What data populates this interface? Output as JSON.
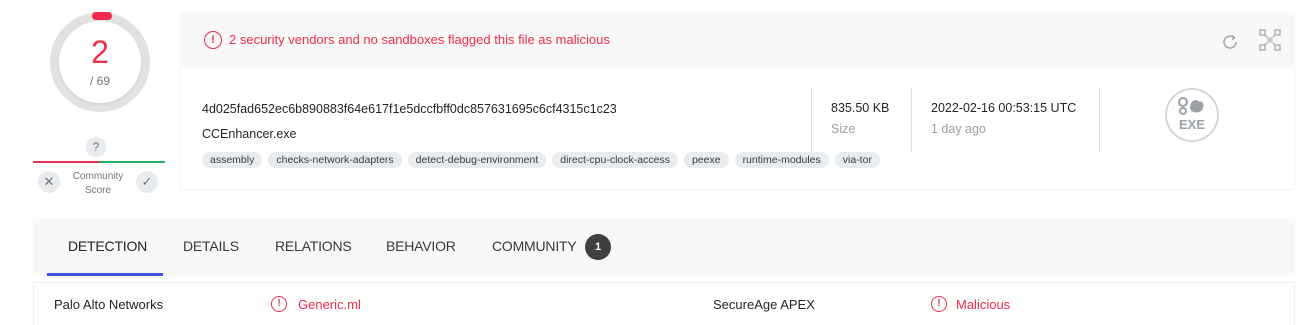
{
  "score": {
    "detections": "2",
    "total": "/ 69"
  },
  "community": {
    "question": "?",
    "label_line1": "Community",
    "label_line2": "Score",
    "downvote": "✕",
    "upvote": "✓"
  },
  "alert": {
    "icon": "!",
    "text": "2 security vendors and no sandboxes flagged this file as malicious"
  },
  "file": {
    "hash": "4d025fad652ec6b890883f64e617f1e5dccfbff0dc857631695c6cf4315c1c23",
    "name": "CCEnhancer.exe",
    "tags": [
      "assembly",
      "checks-network-adapters",
      "detect-debug-environment",
      "direct-cpu-clock-access",
      "peexe",
      "runtime-modules",
      "via-tor"
    ],
    "size_value": "835.50 KB",
    "size_label": "Size",
    "date_value": "2022-02-16 00:53:15 UTC",
    "date_label": "1 day ago",
    "type_label": "EXE"
  },
  "tabs": [
    {
      "label": "DETECTION",
      "active": true
    },
    {
      "label": "DETAILS"
    },
    {
      "label": "RELATIONS"
    },
    {
      "label": "BEHAVIOR"
    },
    {
      "label": "COMMUNITY",
      "badge": "1"
    }
  ],
  "detections": [
    {
      "vendor": "Palo Alto Networks",
      "result": "Generic.ml",
      "icon": "!"
    },
    {
      "vendor": "SecureAge APEX",
      "result": "Malicious",
      "icon": "!"
    }
  ],
  "colors": {
    "malicious": "#ed2e4f",
    "accent": "#3e55e0",
    "harmless": "#27ae60"
  },
  "icons": [
    "reload-icon",
    "graph-icon",
    "exe-file-icon",
    "alert-icon"
  ]
}
